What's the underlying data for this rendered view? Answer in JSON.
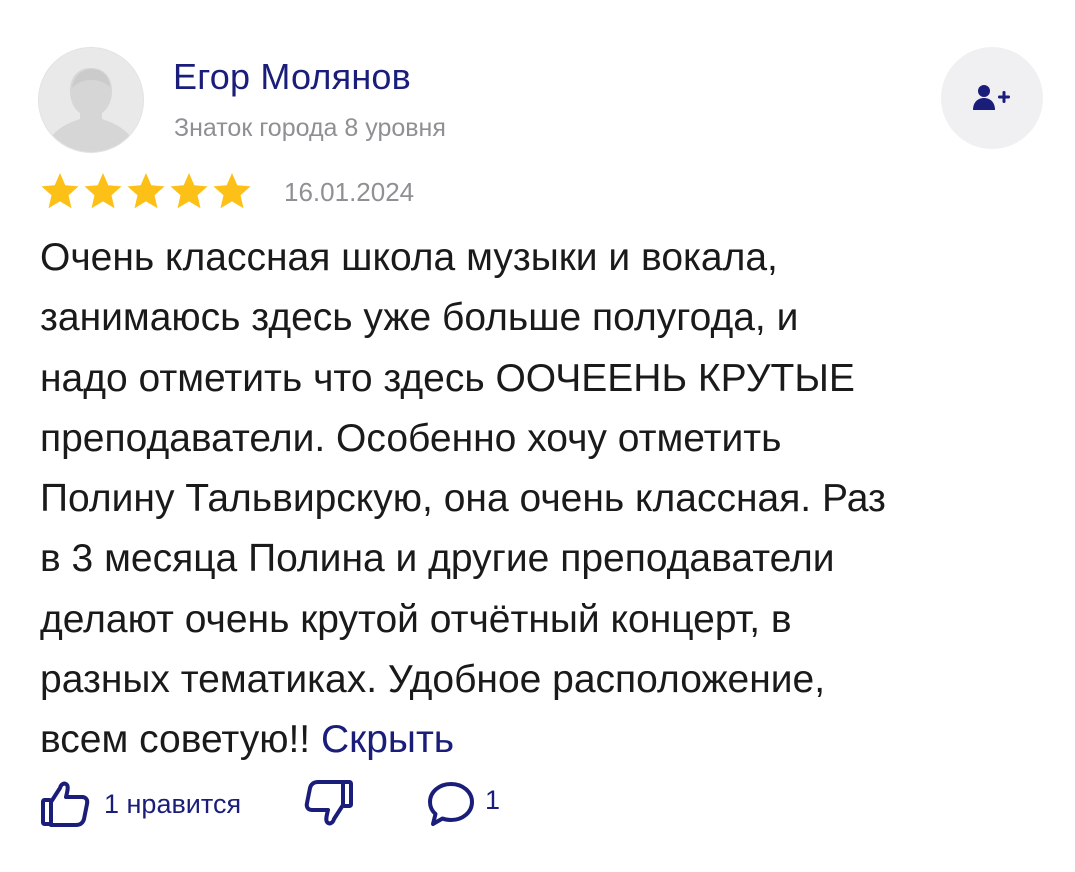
{
  "author": {
    "name": "Егор Молянов",
    "level": "Знаток города 8 уровня",
    "avatar_icon": "default-user-silhouette-icon",
    "subscribe_icon": "add-user-icon"
  },
  "rating": {
    "stars": 5,
    "max": 5,
    "star_color": "#fcc017"
  },
  "date": "16.01.2024",
  "review": {
    "lines": [
      "Очень классная школа музыки и вокала,",
      "занимаюсь здесь уже больше полугода, и",
      "надо отметить что здесь ООЧЕЕНЬ КРУТЫЕ",
      "преподаватели. Особенно хочу отметить",
      "Полину Тальвирскую, она очень классная. Раз",
      "в 3 месяца Полина и другие преподаватели",
      "делают очень крутой отчётный концерт, в",
      "разных тематиках. Удобное расположение,",
      "всем советую!!"
    ],
    "hide_label": "Скрыть"
  },
  "actions": {
    "like_label": "1 нравится",
    "like_icon": "thumbs-up-icon",
    "dislike_icon": "thumbs-down-icon",
    "comment_icon": "comment-bubble-icon",
    "comment_count": "1"
  },
  "colors": {
    "accent": "#1a1e7a",
    "muted": "#8f9093",
    "text": "#1a1a1a"
  }
}
